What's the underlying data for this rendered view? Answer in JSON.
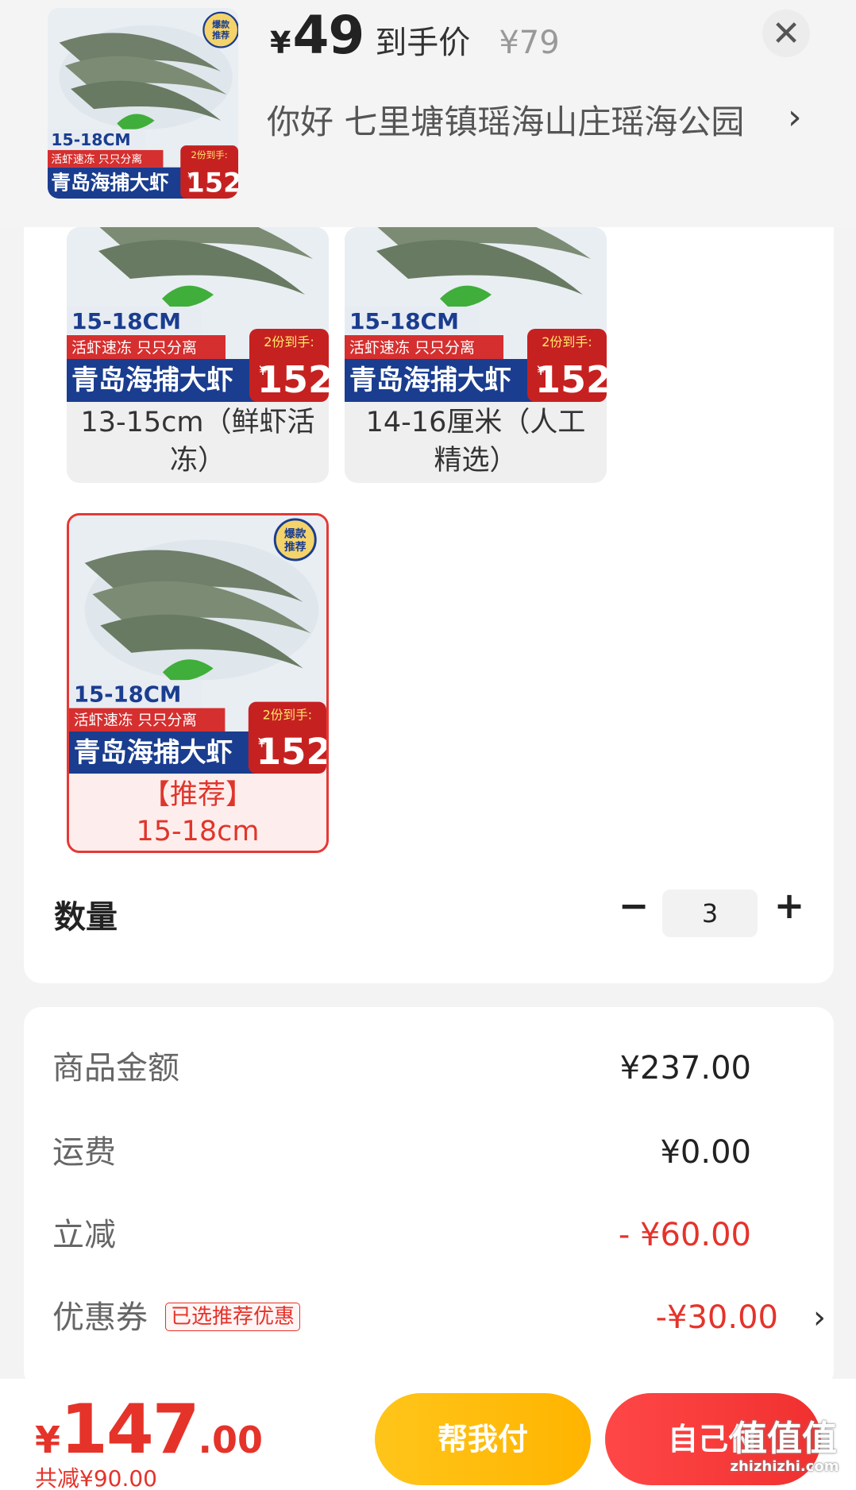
{
  "header": {
    "price_currency": "¥",
    "price_value": "49",
    "price_label": "到手价",
    "original_price": "¥79",
    "close_icon": "close-icon",
    "address": "你好  七里塘镇瑶海山庄瑶海公园",
    "address_arrow": "›"
  },
  "product_image": {
    "size_text": "15-18CM",
    "sub_text": "活虾速冻 只只分离",
    "brand_text": "青岛海捕大虾",
    "promo_text": "2份到手:",
    "promo_price": "152",
    "promo_currency": "¥",
    "badge_line1": "爆款",
    "badge_line2": "推荐"
  },
  "options": [
    {
      "label": "13-15cm（鲜虾活冻）",
      "selected": false
    },
    {
      "label": "14-16厘米（人工精选）",
      "selected": false
    },
    {
      "label_line1": "【推荐】",
      "label_line2": "15-18cm",
      "selected": true
    }
  ],
  "quantity": {
    "label": "数量",
    "minus": "−",
    "value": "3",
    "plus": "+"
  },
  "price_detail": {
    "goods_label": "商品金额",
    "goods_value": "¥237.00",
    "shipping_label": "运费",
    "shipping_value": "¥0.00",
    "discount_label": "立减",
    "discount_value": "- ¥60.00",
    "coupon_label": "优惠券",
    "coupon_tag": "已选推荐优惠",
    "coupon_value": "-¥30.00",
    "coupon_arrow": "›"
  },
  "bottom": {
    "total_currency": "¥",
    "total_int": "147",
    "total_dec": ".00",
    "saved_text": "共减¥90.00",
    "help_pay_label": "帮我付",
    "self_pay_label": "自己付"
  },
  "watermark": {
    "main": "值值值",
    "sub": "zhizhizhi.com"
  },
  "colors": {
    "accent_red": "#e5332a",
    "help_button": "#ffbb0d",
    "shrimp_banner_blue": "#1a3d8f"
  }
}
